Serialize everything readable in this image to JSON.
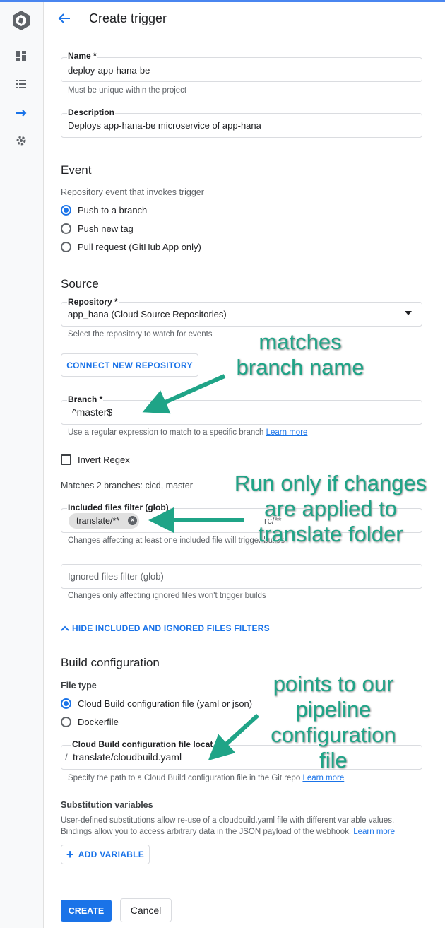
{
  "header": {
    "title": "Create trigger"
  },
  "nav": {
    "icons": [
      "dashboard-icon",
      "history-icon",
      "triggers-icon",
      "settings-icon"
    ]
  },
  "name": {
    "label": "Name *",
    "value": "deploy-app-hana-be",
    "hint": "Must be unique within the project"
  },
  "description": {
    "label": "Description",
    "value": "Deploys app-hana-be microservice of app-hana"
  },
  "event": {
    "title": "Event",
    "subtitle": "Repository event that invokes trigger",
    "options": [
      "Push to a branch",
      "Push new tag",
      "Pull request (GitHub App only)"
    ],
    "selected": "Push to a branch"
  },
  "source": {
    "title": "Source",
    "repository": {
      "label": "Repository *",
      "value": "app_hana (Cloud Source Repositories)",
      "hint": "Select the repository to watch for events"
    },
    "connect_button": "CONNECT NEW REPOSITORY",
    "branch": {
      "label": "Branch *",
      "value": "^master$",
      "hint": "Use a regular expression to match to a specific branch",
      "learn_more": "Learn more"
    },
    "invert_regex": "Invert Regex",
    "matches": "Matches 2 branches: cicd, master",
    "included": {
      "label": "Included files filter (glob)",
      "chip": "translate/**",
      "trailing_text": "rc/**",
      "hint": "Changes affecting at least one included file will trigger builds"
    },
    "ignored": {
      "placeholder": "Ignored files filter (glob)",
      "hint": "Changes only affecting ignored files won't trigger builds"
    },
    "hide_filters": "HIDE INCLUDED AND IGNORED FILES FILTERS"
  },
  "build": {
    "title": "Build configuration",
    "file_type": "File type",
    "options": [
      "Cloud Build configuration file (yaml or json)",
      "Dockerfile"
    ],
    "selected": "Cloud Build configuration file (yaml or json)",
    "location": {
      "label": "Cloud Build configuration file location",
      "prefix": "/",
      "value": "translate/cloudbuild.yaml",
      "hint": "Specify the path to a Cloud Build configuration file in the Git repo",
      "learn_more": "Learn more"
    },
    "substitution": {
      "title": "Substitution variables",
      "line1": "User-defined substitutions allow re-use of a cloudbuild.yaml file with different variable values.",
      "line2": "Bindings allow you to access arbitrary data in the JSON payload of the webhook.",
      "learn_more": "Learn more",
      "add_button": "ADD VARIABLE"
    }
  },
  "actions": {
    "create": "CREATE",
    "cancel": "Cancel"
  },
  "annotations": {
    "branch": [
      "matches",
      "branch name"
    ],
    "filter": [
      "Run only if changes",
      "are applied to",
      "translate folder"
    ],
    "config": [
      "points to our",
      "pipeline",
      "configuration",
      "file"
    ]
  },
  "colors": {
    "accent": "#1a73e8",
    "annotation": "#1fa487",
    "top_line": "#4a86f0"
  }
}
